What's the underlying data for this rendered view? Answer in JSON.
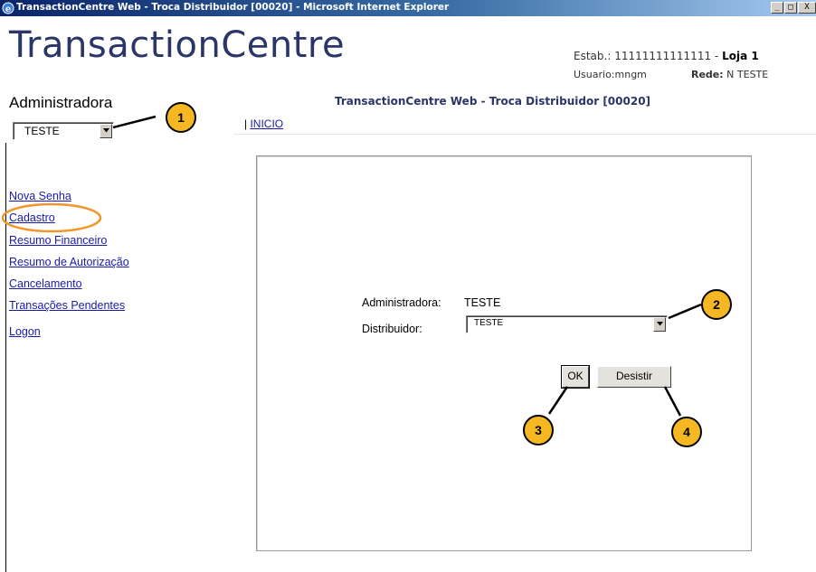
{
  "window": {
    "title": "TransactionCentre Web - Troca Distribuidor [00020] - Microsoft Internet Explorer",
    "controls": [
      "minimize",
      "restore",
      "close"
    ]
  },
  "header": {
    "brand": "TransactionCentre",
    "estab_label": "Estab.:",
    "estab_value": "11111111111111",
    "estab_sep": " - ",
    "loja": "Loja 1",
    "usuario": "Usuario:mngm",
    "rede_label": "Rede:",
    "rede_value": "N TESTE"
  },
  "sidebar": {
    "administradora_label": "Administradora",
    "administradora_selected": "TESTE",
    "links": [
      "Nova Senha",
      "Cadastro",
      "Resumo Financeiro",
      "Resumo de Autorização",
      "Cancelamento",
      "Transações Pendentes",
      "Logon"
    ]
  },
  "main": {
    "page_title": "TransactionCentre Web - Troca Distribuidor [00020]",
    "breadcrumb_sep": "|",
    "breadcrumb_link": "INICIO",
    "form": {
      "administradora_label": "Administradora:",
      "administradora_value": "TESTE",
      "distribuidor_label": "Distribuidor:",
      "distribuidor_selected": "TESTE",
      "ok_label": "OK",
      "cancel_label": "Desistir"
    }
  },
  "callouts": [
    "1",
    "2",
    "3",
    "4"
  ],
  "colors": {
    "brand": "#2a3568",
    "link": "#1a1aa8",
    "callout_fill": "#f5b822",
    "highlight_ring": "#f0962a"
  }
}
